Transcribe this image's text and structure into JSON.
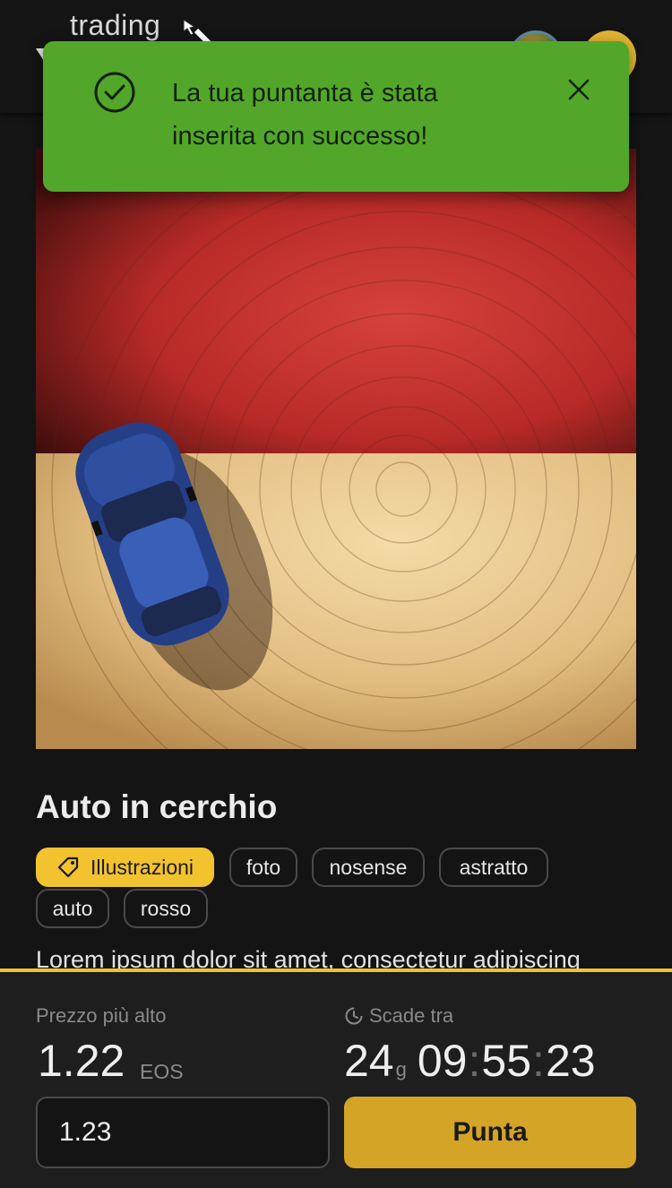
{
  "header": {
    "logo_text": "trading",
    "logo_icon": "logo-mark-icon",
    "avatar_icons": [
      "user-avatar",
      "profile-avatar"
    ]
  },
  "toast": {
    "message": "La tua puntanta è stata inserita con successo!",
    "status_icon": "check-circle-icon",
    "close_icon": "close-icon",
    "color": "#52a72a"
  },
  "artwork": {
    "title": "Auto in cerchio",
    "category": "Illustrazioni",
    "category_icon": "tag-icon",
    "tags": [
      "foto",
      "nosense",
      "astratto",
      "auto",
      "rosso"
    ],
    "description": "Lorem ipsum dolor sit amet, consectetur adipiscing"
  },
  "auction": {
    "highest_label": "Prezzo più alto",
    "highest_price": "1.22",
    "currency": "EOS",
    "expires_label": "Scade tra",
    "expires_icon": "clock-icon",
    "days": "24",
    "days_unit": "g",
    "hours": "09",
    "minutes": "55",
    "seconds": "23",
    "bid_value": "1.23",
    "bid_button": "Punta",
    "accent_color": "#f2c22f"
  }
}
